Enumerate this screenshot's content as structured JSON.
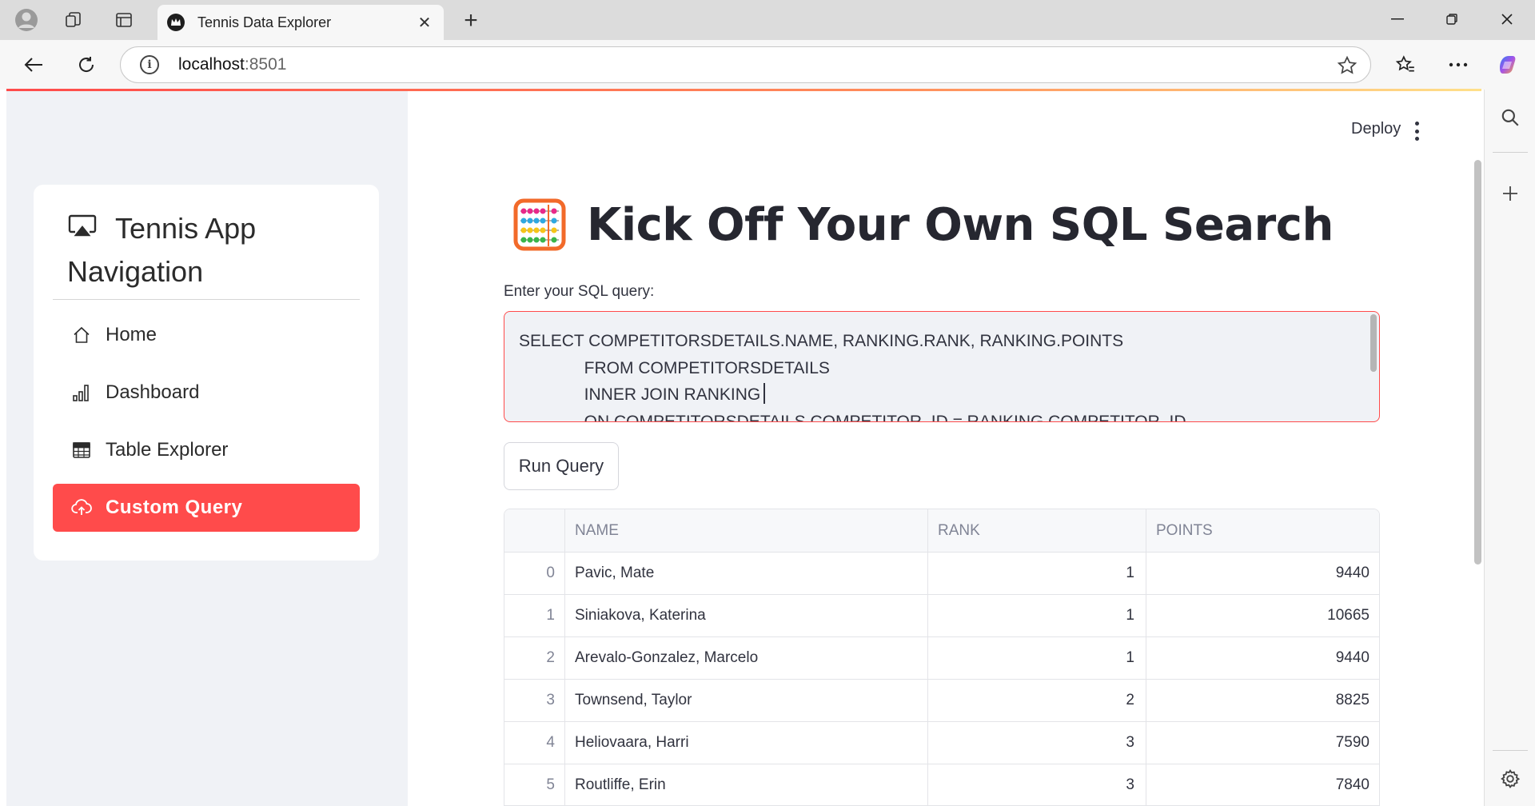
{
  "browser": {
    "tab_title": "Tennis Data Explorer",
    "url_host": "localhost",
    "url_port": ":8501"
  },
  "sidebar": {
    "title": "Tennis App Navigation",
    "items": [
      {
        "label": "Home",
        "icon": "home-icon",
        "active": false
      },
      {
        "label": "Dashboard",
        "icon": "bar-chart-icon",
        "active": false
      },
      {
        "label": "Table Explorer",
        "icon": "table-icon",
        "active": false
      },
      {
        "label": "Custom Query",
        "icon": "cloud-upload-icon",
        "active": true
      }
    ],
    "active_color": "#ff4b4b"
  },
  "header": {
    "deploy_label": "Deploy"
  },
  "main": {
    "title": "Kick Off Your Own SQL Search",
    "title_icon": "abacus-icon",
    "query_label": "Enter your SQL query:",
    "query_text": "SELECT COMPETITORSDETAILS.NAME, RANKING.RANK, RANKING.POINTS\n              FROM COMPETITORSDETAILS\n              INNER JOIN RANKING\n              ON COMPETITORSDETAILS.COMPETITOR_ID = RANKING.COMPETITOR_ID",
    "run_label": "Run Query"
  },
  "table": {
    "columns": [
      "NAME",
      "RANK",
      "POINTS"
    ],
    "rows": [
      {
        "index": "0",
        "name": "Pavic, Mate",
        "rank": "1",
        "points": "9440"
      },
      {
        "index": "1",
        "name": "Siniakova, Katerina",
        "rank": "1",
        "points": "10665"
      },
      {
        "index": "2",
        "name": "Arevalo-Gonzalez, Marcelo",
        "rank": "1",
        "points": "9440"
      },
      {
        "index": "3",
        "name": "Townsend, Taylor",
        "rank": "2",
        "points": "8825"
      },
      {
        "index": "4",
        "name": "Heliovaara, Harri",
        "rank": "3",
        "points": "7590"
      },
      {
        "index": "5",
        "name": "Routliffe, Erin",
        "rank": "3",
        "points": "7840"
      }
    ]
  },
  "colors": {
    "accent": "#ff4b4b",
    "sidebar_bg": "#f0f2f6",
    "text": "#31333f"
  }
}
